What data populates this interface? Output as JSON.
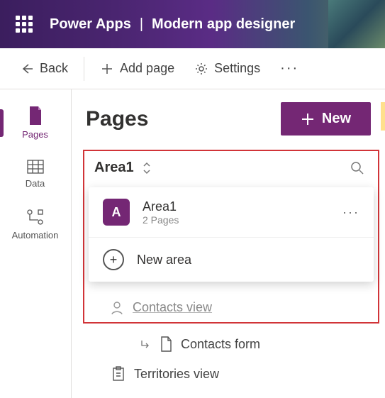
{
  "header": {
    "app": "Power Apps",
    "designer": "Modern app designer"
  },
  "toolbar": {
    "back": "Back",
    "addPage": "Add page",
    "settings": "Settings"
  },
  "sidebar": {
    "items": [
      {
        "label": "Pages"
      },
      {
        "label": "Data"
      },
      {
        "label": "Automation"
      }
    ]
  },
  "main": {
    "title": "Pages",
    "newButton": "New",
    "areaLabel": "Area1",
    "dropdown": {
      "area": {
        "badge": "A",
        "title": "Area1",
        "sub": "2 Pages"
      },
      "newArea": "New area"
    },
    "tree": {
      "contactsView": "Contacts view",
      "contactsForm": "Contacts form",
      "territoriesView": "Territories view"
    }
  }
}
